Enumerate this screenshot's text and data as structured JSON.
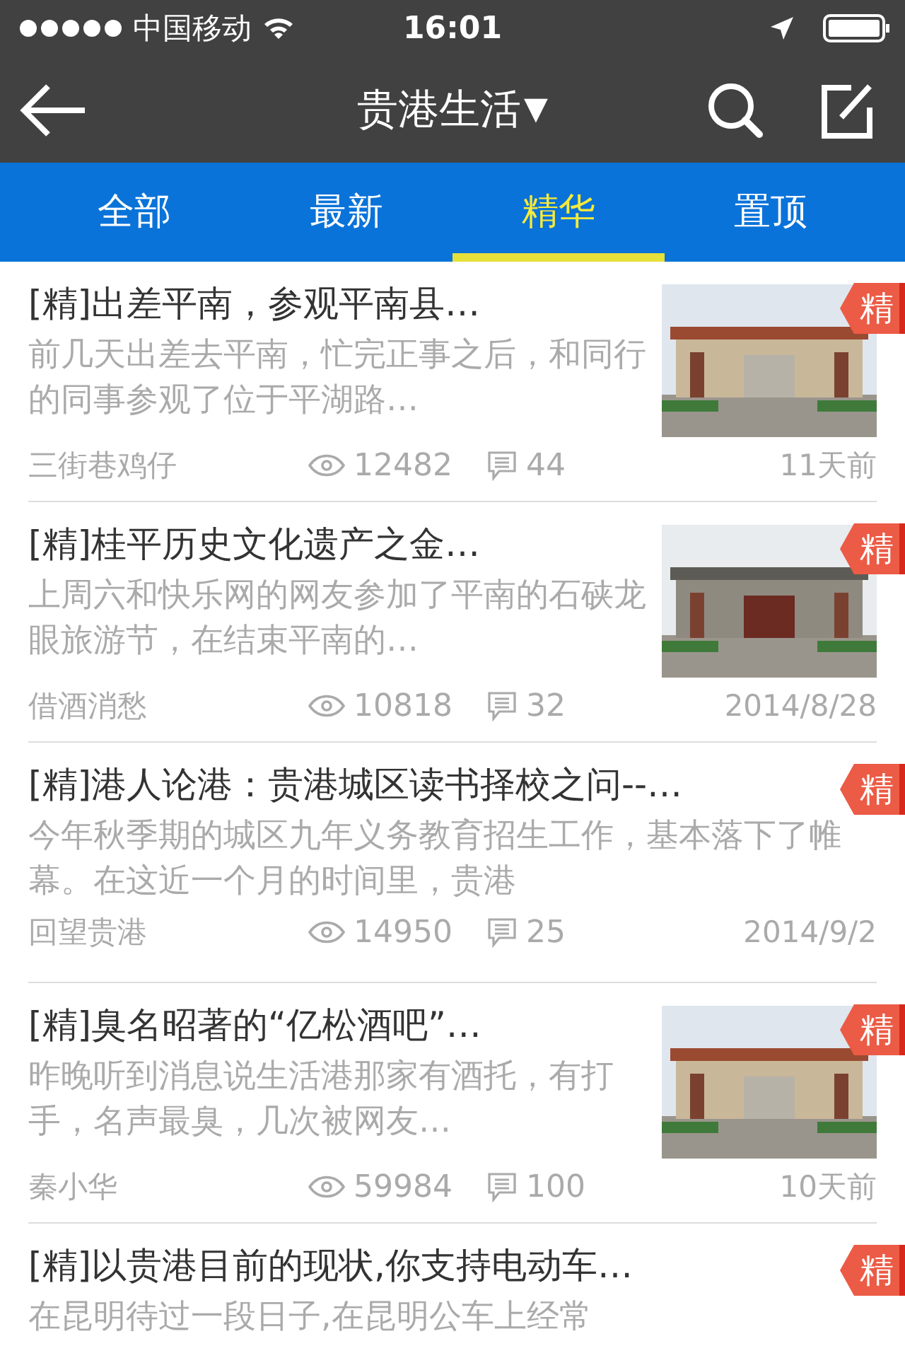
{
  "status_bar": {
    "carrier": "中国移动",
    "time": "16:01"
  },
  "nav": {
    "title": "贵港生活",
    "title_caret": "▼"
  },
  "tabs": [
    {
      "label": "全部",
      "selected": false
    },
    {
      "label": "最新",
      "selected": false
    },
    {
      "label": "精华",
      "selected": true
    },
    {
      "label": "置顶",
      "selected": false
    }
  ],
  "posts": [
    {
      "title": "[精]出差平南，参观平南县…",
      "summary": "前几天出差去平南，忙完正事之后，和同行的同事参观了位于平湖路…",
      "author": "三街巷鸡仔",
      "views": "12482",
      "comments": "44",
      "time": "11天前",
      "badge": "精"
    },
    {
      "title": "[精]桂平历史文化遗产之金…",
      "summary": "上周六和快乐网的网友参加了平南的石硖龙眼旅游节，在结束平南的…",
      "author": "借酒消愁",
      "views": "10818",
      "comments": "32",
      "time": "2014/8/28",
      "badge": "精"
    },
    {
      "title": "[精]港人论港：贵港城区读书择校之问--…",
      "summary": "今年秋季期的城区九年义务教育招生工作，基本落下了帷幕。在这近一个月的时间里，贵港",
      "author": "回望贵港",
      "views": "14950",
      "comments": "25",
      "time": "2014/9/2",
      "badge": "精"
    },
    {
      "title": "[精]臭名昭著的“亿松酒吧”…",
      "summary": "昨晚听到消息说生活港那家有酒托，有打手，名声最臭，几次被网友…",
      "author": "秦小华",
      "views": "59984",
      "comments": "100",
      "time": "10天前",
      "badge": "精"
    },
    {
      "title": "[精]以贵港目前的现状,你支持电动车…",
      "summary": "在昆明待过一段日子,在昆明公车上经常",
      "badge": "精"
    }
  ]
}
